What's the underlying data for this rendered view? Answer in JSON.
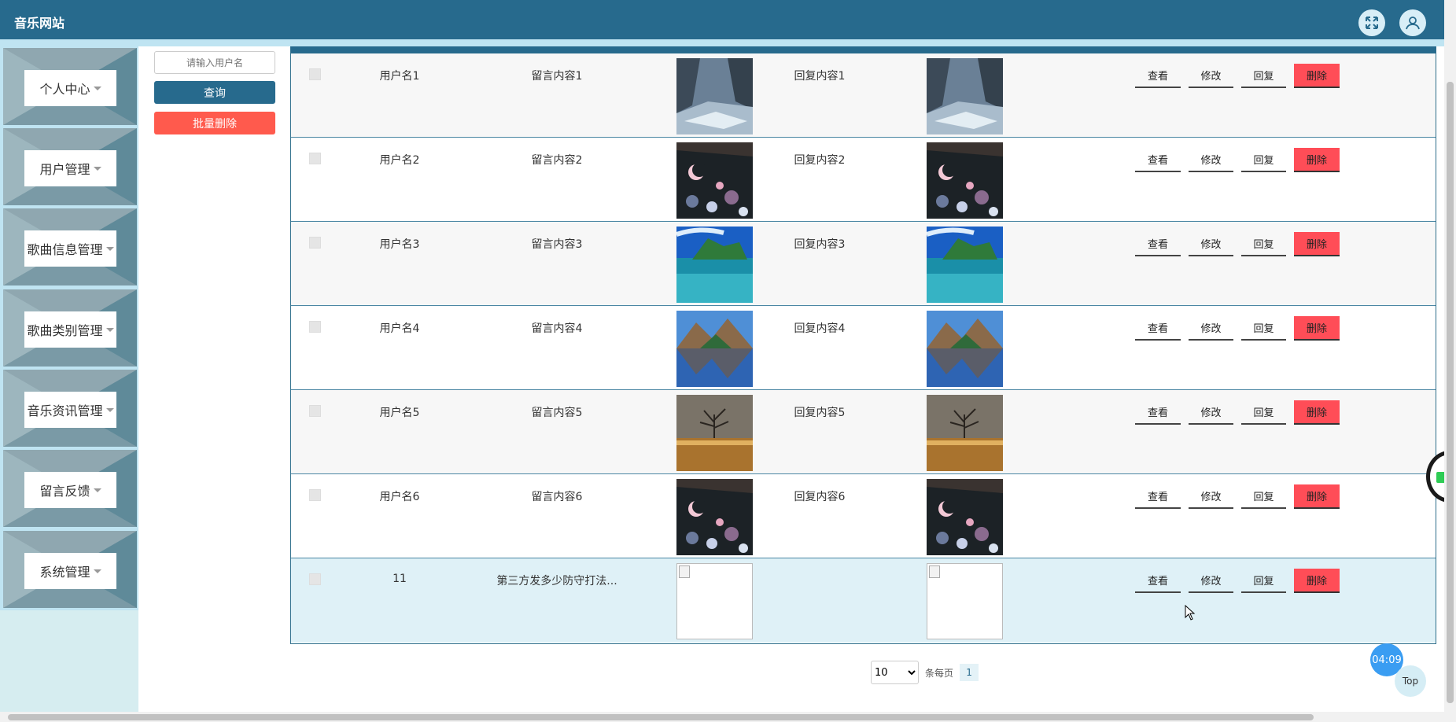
{
  "app": {
    "title": "音乐网站"
  },
  "header": {
    "expand_icon": "fullscreen-icon",
    "user_icon": "user-icon"
  },
  "sidebar": {
    "items": [
      {
        "label": "个人中心"
      },
      {
        "label": "用户管理"
      },
      {
        "label": "歌曲信息管理"
      },
      {
        "label": "歌曲类别管理"
      },
      {
        "label": "音乐资讯管理"
      },
      {
        "label": "留言反馈"
      },
      {
        "label": "系统管理"
      }
    ]
  },
  "search": {
    "placeholder": "请输入用户名",
    "query_label": "查询",
    "batch_delete_label": "批量删除"
  },
  "actions": {
    "view": "查看",
    "edit": "修改",
    "reply": "回复",
    "delete": "删除"
  },
  "colors": {
    "header": "#276a8d",
    "delete": "#ff4d57",
    "batch_delete": "#ff5a4d",
    "sidebar_bg": "#bfe4f2"
  },
  "rows": [
    {
      "username": "用户名1",
      "message": "留言内容1",
      "reply": "回复内容1",
      "image": "river-valley"
    },
    {
      "username": "用户名2",
      "message": "留言内容2",
      "reply": "回复内容2",
      "image": "moon-flowers"
    },
    {
      "username": "用户名3",
      "message": "留言内容3",
      "reply": "回复内容3",
      "image": "tropical-lagoon"
    },
    {
      "username": "用户名4",
      "message": "留言内容4",
      "reply": "回复内容4",
      "image": "mountain-lake"
    },
    {
      "username": "用户名5",
      "message": "留言内容5",
      "reply": "回复内容5",
      "image": "lone-tree"
    },
    {
      "username": "用户名6",
      "message": "留言内容6",
      "reply": "回复内容6",
      "image": "moon-flowers"
    },
    {
      "username": "11",
      "message": "第三方发多少防守打法...",
      "reply": "",
      "image": "broken-image"
    }
  ],
  "pagination": {
    "page_size": "10",
    "per_page_label": "条每页",
    "current_page": "1"
  },
  "widgets": {
    "timer": "04:09",
    "top_label": "Top"
  }
}
